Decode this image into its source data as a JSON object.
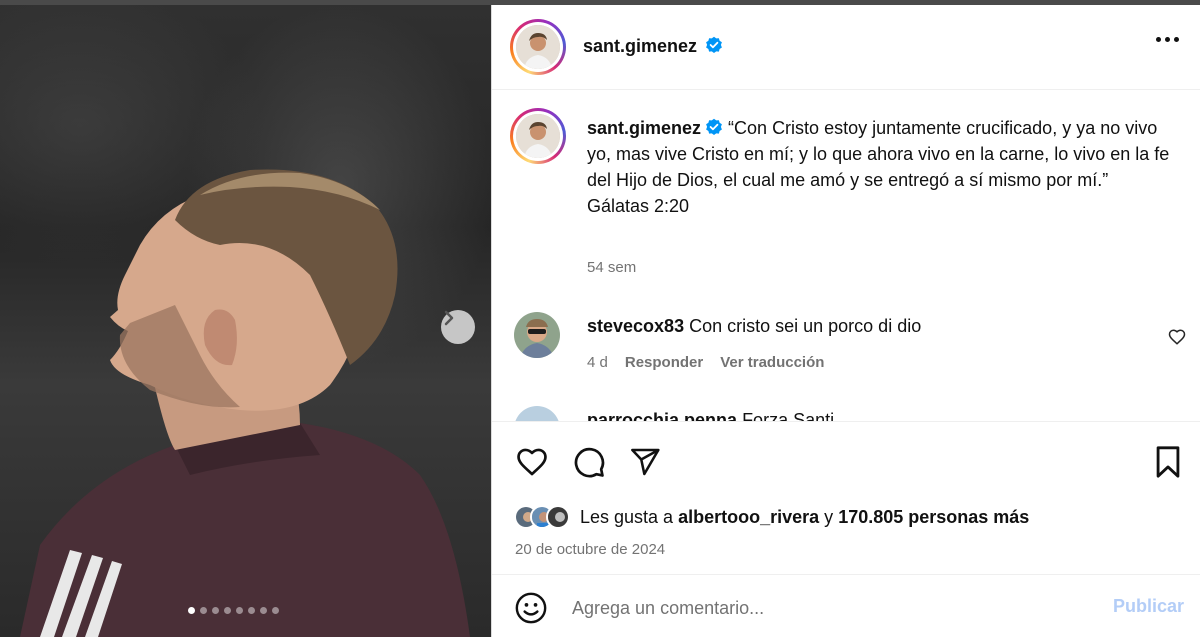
{
  "post": {
    "username": "sant.gimenez",
    "verified": true,
    "more_icon": "more-horizontal-icon",
    "carousel": {
      "count": 8,
      "active_index": 0,
      "next_icon": "chevron-right-icon"
    }
  },
  "caption": {
    "username": "sant.gimenez",
    "text": "“Con Cristo estoy juntamente crucificado, y ya no vivo yo, mas vive Cristo en mí; y lo que ahora vivo en la carne, lo vivo en la fe del Hijo de Dios, el cual me amó y se entregó a sí mismo por mí.”",
    "reference": "Gálatas 2:20",
    "time": "54 sem"
  },
  "comments": [
    {
      "username": "stevecox83",
      "text": "Con cristo sei un porco di dio",
      "time": "4 d",
      "reply_label": "Responder",
      "translate_label": "Ver traducción"
    },
    {
      "username": "parrocchia.penna",
      "text": "Forza Santi"
    }
  ],
  "actions": {
    "like_icon": "heart-icon",
    "comment_icon": "comment-icon",
    "share_icon": "send-icon",
    "save_icon": "bookmark-icon"
  },
  "likes": {
    "prefix": "Les gusta a",
    "user": "albertooo_rivera",
    "connector": "y",
    "others": "170.805 personas más"
  },
  "date": "20 de octubre de 2024",
  "add_comment": {
    "emoji_icon": "emoji-icon",
    "placeholder": "Agrega un comentario...",
    "publish_label": "Publicar"
  },
  "colors": {
    "verified": "#0095f6",
    "publish_disabled": "#b3cdf7",
    "secondary_text": "#737373"
  }
}
